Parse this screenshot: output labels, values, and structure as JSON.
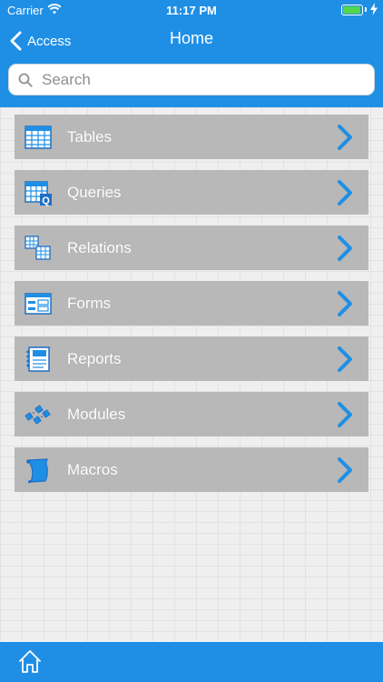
{
  "status_bar": {
    "carrier": "Carrier",
    "time": "11:17 PM",
    "battery_level": 1.0,
    "battery_color": "#54d64d",
    "wifi_icon": "wifi-icon",
    "charging_icon": "charging-icon"
  },
  "nav": {
    "back_label": "Access",
    "title": "Home"
  },
  "search": {
    "placeholder": "Search",
    "value": ""
  },
  "menu": {
    "items": [
      {
        "label": "Tables",
        "icon": "table-grid-icon"
      },
      {
        "label": "Queries",
        "icon": "query-grid-icon"
      },
      {
        "label": "Relations",
        "icon": "relations-icon"
      },
      {
        "label": "Forms",
        "icon": "form-icon"
      },
      {
        "label": "Reports",
        "icon": "report-icon"
      },
      {
        "label": "Modules",
        "icon": "modules-icon"
      },
      {
        "label": "Macros",
        "icon": "macro-scroll-icon"
      }
    ]
  },
  "bottom_bar": {
    "home_icon": "home-icon"
  },
  "colors": {
    "accent": "#1f8fe6",
    "item_background": "#b8b8b8",
    "chevron": "#1f8fe6"
  }
}
